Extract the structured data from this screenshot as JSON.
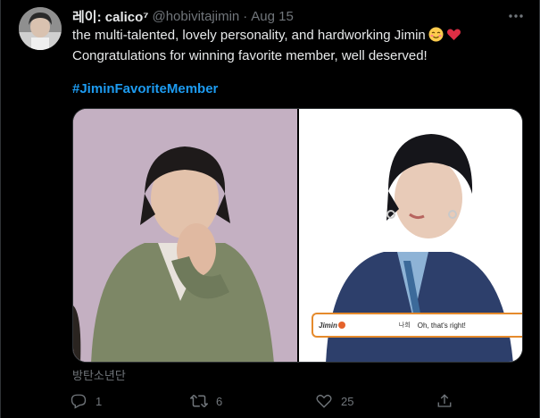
{
  "tweet": {
    "display_name": "레이: calico⁷",
    "handle": "@hobivitajimin",
    "separator": "·",
    "date": "Aug 15",
    "text_line1": "the multi-talented, lovely personality, and hardworking Jimin",
    "text_line2": "Congratulations for winning favorite member, well deserved!",
    "hashtag": "#JiminFavoriteMember",
    "media_alt": "방탄소년단",
    "media_caption": {
      "tag": "Jimin",
      "korean": "나희",
      "english": "Oh, that's right!"
    },
    "emojis": [
      "relieved-face",
      "red-heart"
    ]
  },
  "actions": {
    "reply_count": "1",
    "retweet_count": "6",
    "like_count": "25"
  },
  "colors": {
    "background": "#000000",
    "text": "#e7e9ea",
    "secondary": "#71767b",
    "link": "#1d9bf0",
    "heart": "#f91880"
  }
}
